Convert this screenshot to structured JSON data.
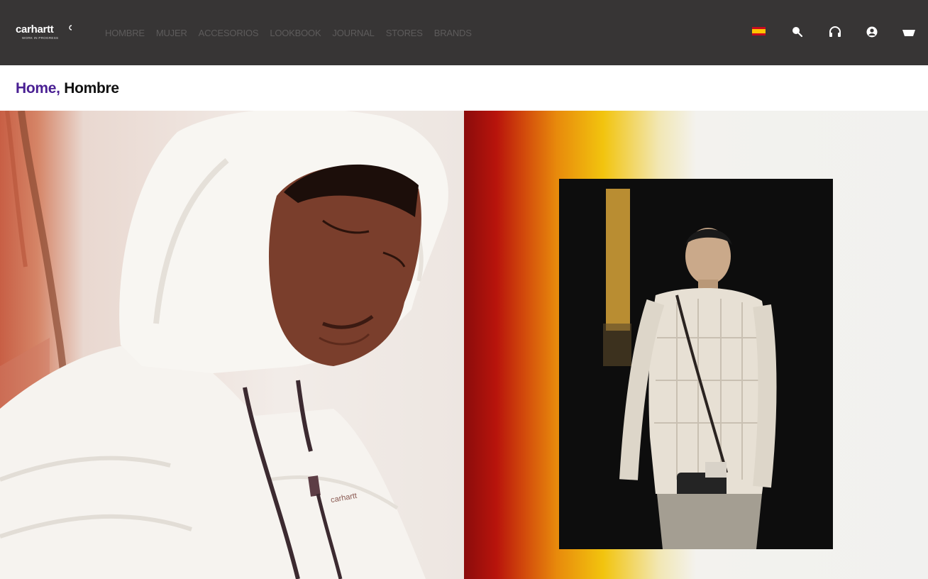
{
  "header": {
    "logo": {
      "word": "carhartt",
      "tagline": "WORK IN PROGRESS"
    },
    "nav": [
      {
        "label": "HOMBRE"
      },
      {
        "label": "MUJER"
      },
      {
        "label": "ACCESORIOS"
      },
      {
        "label": "LOOKBOOK"
      },
      {
        "label": "JOURNAL"
      },
      {
        "label": "STORES"
      },
      {
        "label": "BRANDS"
      }
    ],
    "icons": [
      "spain-flag-icon",
      "search-icon",
      "headset-icon",
      "account-icon",
      "cart-icon"
    ]
  },
  "breadcrumb": {
    "home": "Home,",
    "current": "Hombre"
  },
  "colors": {
    "header_bg": "#373535",
    "nav_text": "#5d5b5b",
    "breadcrumb_link": "#4a2093",
    "breadcrumb_current": "#111111"
  },
  "hero": {
    "left_image_logo": "carhartt"
  }
}
